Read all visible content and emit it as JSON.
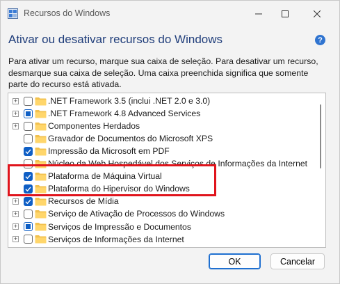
{
  "window": {
    "title": "Recursos do Windows",
    "heading": "Ativar ou desativar recursos do Windows",
    "help_label": "?",
    "description": "Para ativar um recurso, marque sua caixa de seleção. Para desativar um recurso, desmarque sua caixa de seleção. Uma caixa preenchida significa que somente parte do recurso está ativada."
  },
  "features": [
    {
      "label": ".NET Framework 3.5 (inclui .NET 2.0 e 3.0)",
      "state": "empty",
      "expandable": true
    },
    {
      "label": ".NET Framework 4.8 Advanced Services",
      "state": "partial",
      "expandable": true
    },
    {
      "label": "Componentes Herdados",
      "state": "empty",
      "expandable": true
    },
    {
      "label": "Gravador de Documentos do Microsoft XPS",
      "state": "empty",
      "expandable": false
    },
    {
      "label": "Impressão da Microsoft em PDF",
      "state": "checked",
      "expandable": false
    },
    {
      "label": "Núcleo da Web Hospedável dos Serviços de Informações da Internet",
      "state": "empty",
      "expandable": false
    },
    {
      "label": "Plataforma de Máquina Virtual",
      "state": "checked",
      "expandable": false
    },
    {
      "label": "Plataforma do Hipervisor do Windows",
      "state": "checked",
      "expandable": false
    },
    {
      "label": "Recursos de Mídia",
      "state": "checked",
      "expandable": true
    },
    {
      "label": "Serviço de Ativação de Processos do Windows",
      "state": "empty",
      "expandable": true
    },
    {
      "label": "Serviços de Impressão e Documentos",
      "state": "partial",
      "expandable": true
    },
    {
      "label": "Serviços de Informações da Internet",
      "state": "empty",
      "expandable": true
    }
  ],
  "buttons": {
    "ok": "OK",
    "cancel": "Cancelar"
  },
  "colors": {
    "accent": "#0f5fc5",
    "highlight_border": "#e0141c",
    "heading": "#1f3d7a",
    "folder": "#f2c14e"
  },
  "icons": {
    "app": "windows-features-icon",
    "minimize": "minimize-icon",
    "maximize": "maximize-icon",
    "close": "close-icon",
    "help": "help-icon",
    "folder": "folder-icon",
    "expander": "plus-expander-icon"
  }
}
